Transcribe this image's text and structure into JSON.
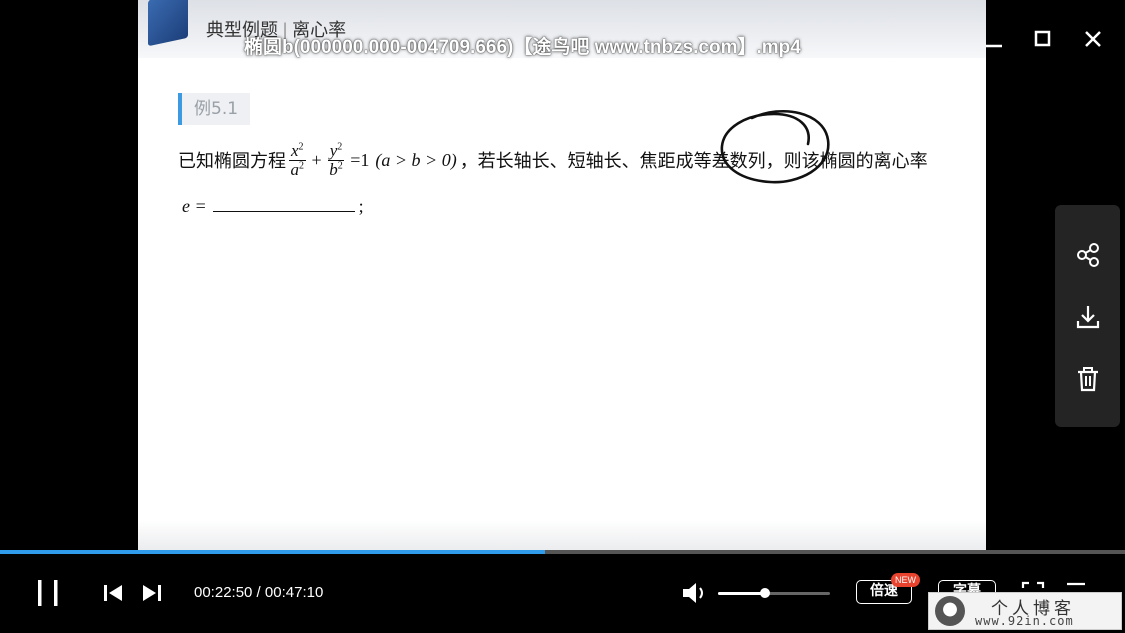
{
  "window": {
    "title": "椭圆b(000000.000-004709.666)【途鸟吧 www.tnbzs.com】.mp4",
    "controls": [
      "minimize-icon",
      "maximize-icon",
      "close-icon"
    ]
  },
  "slide": {
    "section": "典型例题",
    "topic": "离心率",
    "example_tag": "例5.1",
    "problem": {
      "prefix": "已知椭圆方程",
      "frac1_num": "x",
      "frac1_den": "a",
      "plus": "+",
      "frac2_num": "y",
      "frac2_den": "b",
      "exponent": "2",
      "equals": "=1",
      "condition": "(a > b > 0)",
      "suffix": "，若长轴长、短轴长、焦距成等差数列，则该椭圆的离心率"
    },
    "answer_prefix": "e =",
    "answer_end": ";"
  },
  "side_panel": {
    "items": [
      "share-icon",
      "download-icon",
      "trash-icon"
    ]
  },
  "player": {
    "progress_fraction": 0.484,
    "current_time": "00:22:50",
    "duration": "00:47:10",
    "time_separator": " / ",
    "volume_fraction": 0.42,
    "speed_label": "倍速",
    "new_badge": "NEW",
    "subtitle_label": "字幕"
  },
  "watermark": {
    "title": "个人博客",
    "url": "www.92in.com"
  },
  "colors": {
    "accent": "#2f9bea",
    "badge": "#e8432e",
    "panel": "#242424"
  }
}
